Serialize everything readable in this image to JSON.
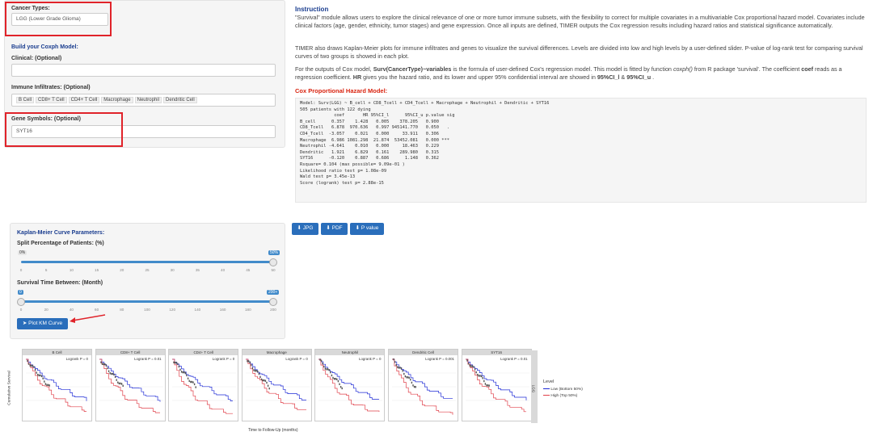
{
  "left_panel": {
    "cancer_types_label": "Cancer Types:",
    "cancer_types_value": "LGG (Lower Grade Glioma)",
    "build_title": "Build your Coxph Model:",
    "clinical_label": "Clinical: (Optional)",
    "clinical_value": "",
    "immune_label": "Immune Infiltrates: (Optional)",
    "immune_tags": [
      "B Cell",
      "CD8+ T Cell",
      "CD4+ T Cell",
      "Macrophage",
      "Neutrophil",
      "Dendritic Cell"
    ],
    "gene_label": "Gene Symbols: (Optional)",
    "gene_value": "SYT16"
  },
  "instruction": {
    "title": "Instruction",
    "para1": "\"Survival\" module allows users to explore the clinical relevance of one or more tumor immune subsets, with the flexibility to correct for multiple covariates in a multivariable Cox proportional hazard model. Covariates include clinical factors (age, gender, ethnicity, tumor stages) and gene expression. Once all inputs are defined, TIMER outputs the Cox regression results including hazard ratios and statistical significance automatically.",
    "para2": "TIMER also draws Kaplan-Meier plots for immune infiltrates and genes to visualize the survival differences. Levels are divided into low and high levels by a user-defined slider. P-value of log-rank test for comparing survival curves of two groups is showed in each plot.",
    "para3_a": "For the outputs of Cox model, ",
    "para3_b": "Surv(CancerType)~variables",
    "para3_c": " is the formula of user-defined Cox's regression model. This model is fitted by function ",
    "para3_d": "coxph()",
    "para3_e": " from R package 'survival'. The coefficient ",
    "para3_f": "coef",
    "para3_g": " reads as a regression coefficient. ",
    "para3_h": "HR",
    "para3_i": " gives you the hazard ratio, and its lower and upper 95% confidential interval are showed in ",
    "para3_j": "95%CI_l",
    "para3_k": " & ",
    "para3_l": "95%CI_u",
    "para3_m": " ."
  },
  "cox": {
    "title": "Cox Proportional Hazard Model:",
    "output": "Model: Surv(LGG) ~ B_cell + CD8_Tcell + CD4_Tcell + Macrophage + Neutrophil + Dendritic + SYT16\n505 patients with 122 dying\n             coef       HR 95%CI_l      95%CI_u p.value sig\nB_cell      0.357    1.428   0.005    378.205   0.900\nCD8_Tcell   6.878  970.636   0.997 945141.770   0.050   .\nCD4_Tcell  -3.057    0.021   0.000     33.911   0.306\nMacrophage  6.986 1081.298  21.874  53452.081   0.000 ***\nNeutrophil -4.641    0.010   0.000     18.463   0.229\nDendritic   1.921    6.829   0.161    289.980   0.315\nSYT16      -0.120    0.887   0.686      1.148   0.362\nRsquare= 0.104 (max possible= 9.09e-01 )\nLikelihood ratio test p= 1.08e-09\nWald test p= 3.45e-13\nScore (logrank) test p= 2.88e-15"
  },
  "km_params": {
    "title": "Kaplan-Meier Curve Parameters:",
    "split_label": "Split Percentage of Patients: (%)",
    "split_min_badge": "0%",
    "split_max_badge": "50%",
    "split_ticks": [
      "0",
      "5",
      "10",
      "15",
      "20",
      "25",
      "30",
      "35",
      "40",
      "45",
      "50"
    ],
    "time_label": "Survival Time Between: (Month)",
    "time_min_badge": "0",
    "time_max_badge": "200+",
    "time_ticks": [
      "0",
      "20",
      "40",
      "60",
      "80",
      "100",
      "120",
      "140",
      "160",
      "180",
      "200"
    ],
    "plot_button": "Plot KM Curve"
  },
  "downloads": {
    "jpg": "JPG",
    "pdf": "PDF",
    "pvalue": "P value"
  },
  "km_plot": {
    "ylabel": "Cumulative Survival",
    "xlabel": "Time to Follow-Up (months)",
    "legend_title": "Level",
    "legend_low": "Low (Bottom 50%)",
    "legend_high": "High (Top 50%)",
    "side_strip": "LGG",
    "colors": {
      "low": "#1f2bd6",
      "high": "#e0404a",
      "censor": "#555555"
    },
    "panels": [
      {
        "name": "B Cell",
        "pval": "Logrank P = 0"
      },
      {
        "name": "CD8+ T Cell",
        "pval": "Logrank P = 0.01"
      },
      {
        "name": "CD4+ T Cell",
        "pval": "Logrank P = 0"
      },
      {
        "name": "Macrophage",
        "pval": "Logrank P = 0"
      },
      {
        "name": "Neutrophil",
        "pval": "Logrank P = 0"
      },
      {
        "name": "Dendritic Cell",
        "pval": "Logrank P = 0.001"
      },
      {
        "name": "SYT16",
        "pval": "Logrank P = 0.01"
      }
    ]
  }
}
